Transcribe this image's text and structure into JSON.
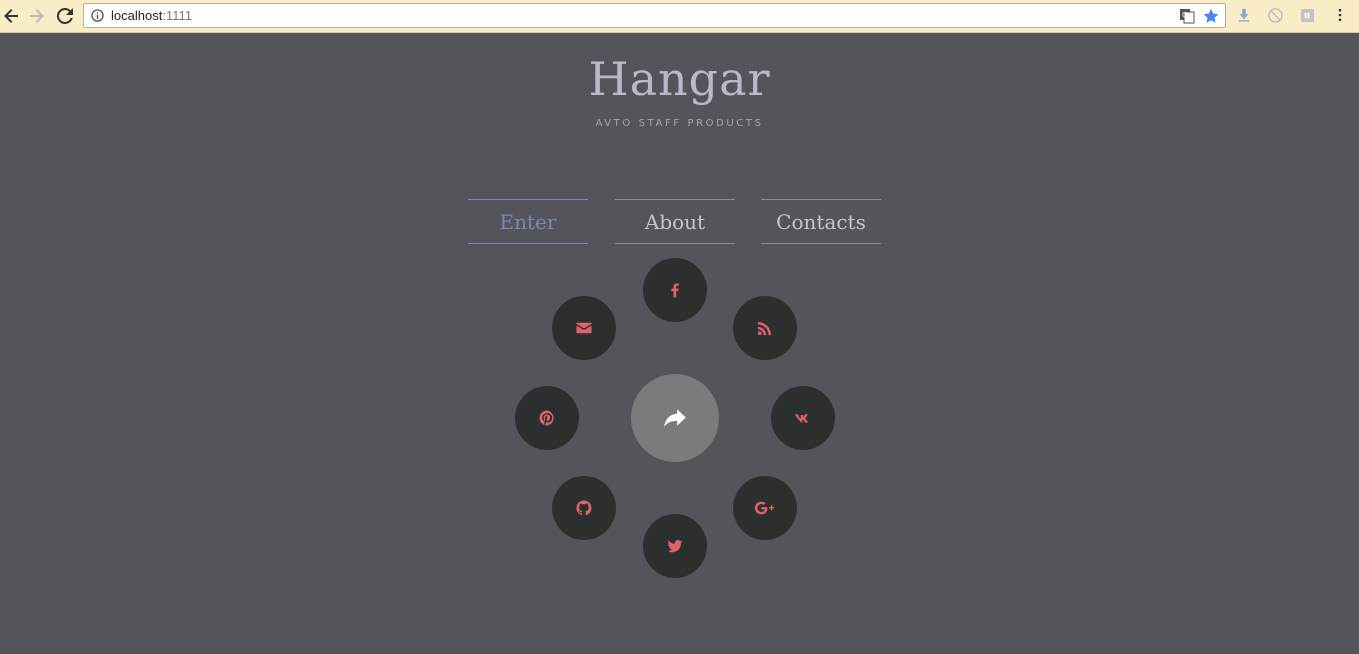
{
  "browser": {
    "url_host": "localhost",
    "url_port": ":1111"
  },
  "header": {
    "title": "Hangar",
    "subtitle": "AVTO STAFF PRODUCTS"
  },
  "menu": [
    {
      "label": "Enter",
      "active": true
    },
    {
      "label": "About",
      "active": false
    },
    {
      "label": "Contacts",
      "active": false
    }
  ],
  "social": {
    "center_icon": "share-icon",
    "items": [
      "facebook-icon",
      "rss-icon",
      "vk-icon",
      "google-plus-icon",
      "twitter-icon",
      "github-icon",
      "pinterest-icon",
      "email-icon"
    ]
  },
  "colors": {
    "background": "#54555b",
    "icon_accent": "#e0626a",
    "active_menu": "#7e86b3"
  }
}
